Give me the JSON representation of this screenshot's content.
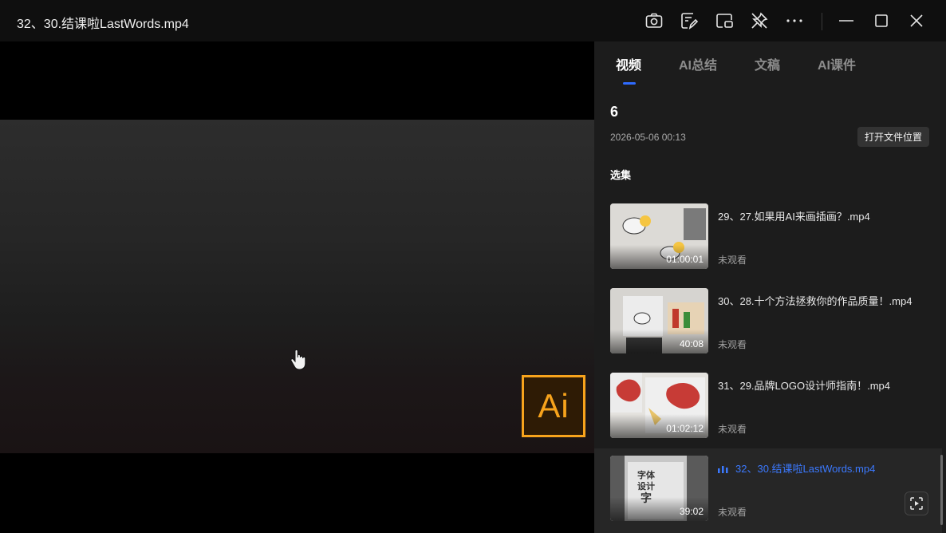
{
  "window": {
    "title": "32、30.结课啦LastWords.mp4"
  },
  "toolbar": {
    "icons": [
      "camera-icon",
      "edit-note-icon",
      "picture-in-picture-icon",
      "pin-off-icon",
      "more-icon",
      "minimize-icon",
      "maximize-icon",
      "close-icon"
    ]
  },
  "video": {
    "logo_text": "Ai",
    "accent": "#f7a31c"
  },
  "panel": {
    "tabs": [
      {
        "label": "视频",
        "active": true
      },
      {
        "label": "AI总结",
        "active": false
      },
      {
        "label": "文稿",
        "active": false
      },
      {
        "label": "AI课件",
        "active": false
      }
    ],
    "count": "6",
    "date": "2026-05-06 00:13",
    "open_location": "打开文件位置",
    "section_title": "选集",
    "episodes": [
      {
        "title": "29、27.如果用AI来画插画？.mp4",
        "duration": "01:00:01",
        "status": "未观看",
        "active": false
      },
      {
        "title": "30、28.十个方法拯救你的作品质量！.mp4",
        "duration": "40:08",
        "status": "未观看",
        "active": false
      },
      {
        "title": "31、29.品牌LOGO设计师指南！.mp4",
        "duration": "01:02:12",
        "status": "未观看",
        "active": false
      },
      {
        "title": "32、30.结课啦LastWords.mp4",
        "duration": "39:02",
        "status": "未观看",
        "active": true
      }
    ],
    "thumb4_text": [
      "字体",
      "设计",
      "字"
    ]
  },
  "colors": {
    "accent_blue": "#2f6bff",
    "panel_bg": "#1c1c1c"
  }
}
